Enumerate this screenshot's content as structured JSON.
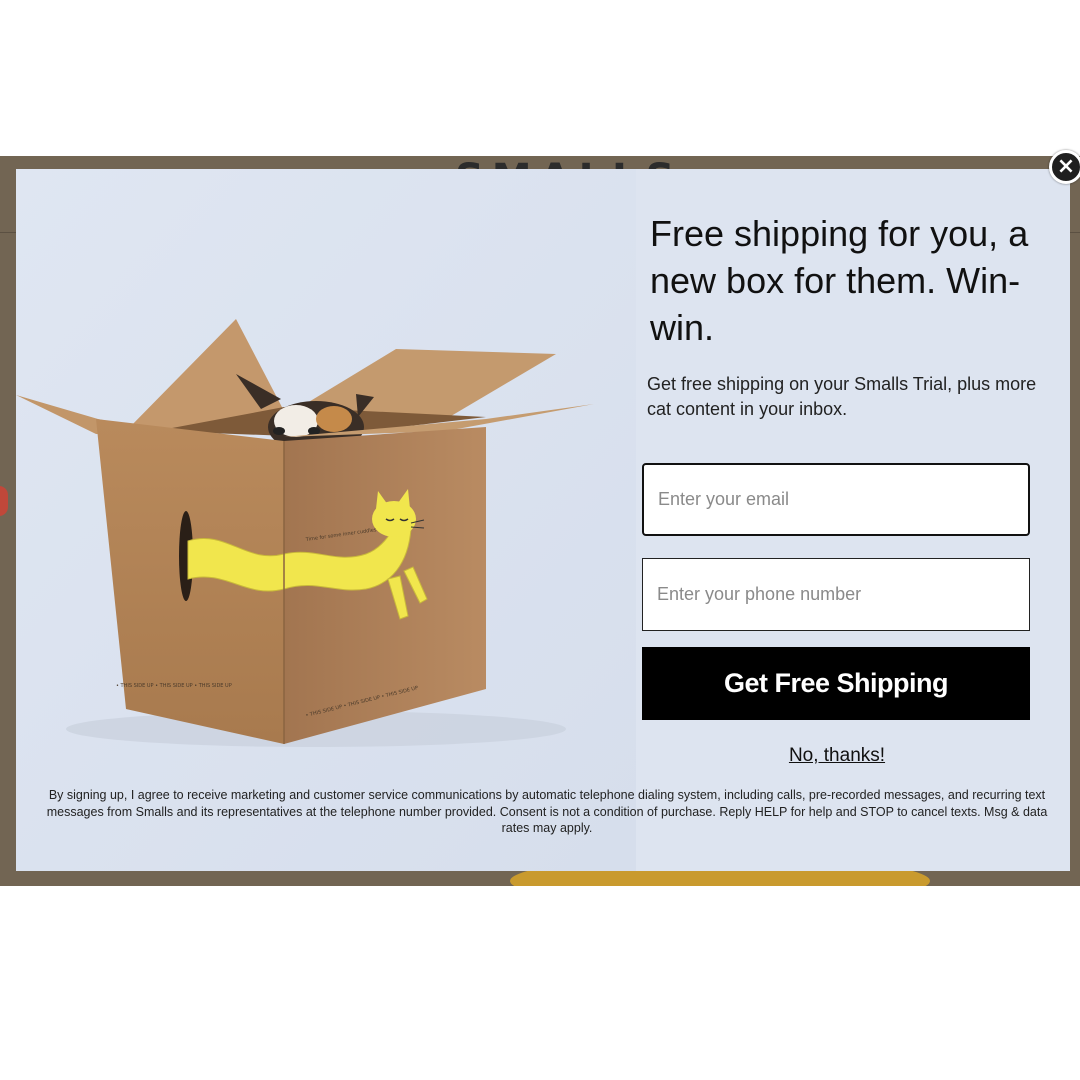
{
  "modal": {
    "headline": "Free shipping for you, a new box for them. Win-win.",
    "subhead": "Get free shipping on your Smalls Trial, plus more cat content in your inbox.",
    "email_placeholder": "Enter your email",
    "phone_placeholder": "Enter your phone number",
    "cta_label": "Get Free Shipping",
    "decline_label": "No, thanks!",
    "disclaimer": "By signing up, I agree to receive marketing and customer service communications by automatic telephone dialing system, including calls, pre-recorded messages, and recurring text messages from Smalls and its representatives at the telephone number provided. Consent is not a condition of purchase. Reply HELP for help and STOP to cancel texts. Msg & data rates may apply.",
    "close_icon": "×",
    "hero_icon": "cat-in-box-illustration"
  },
  "colors": {
    "modal_bg": "#dde4f0",
    "cta_bg": "#000000",
    "cta_text": "#ffffff",
    "box_brown": "#b88a5e",
    "cat_yellow": "#f3e94a",
    "backdrop": "#726553"
  }
}
